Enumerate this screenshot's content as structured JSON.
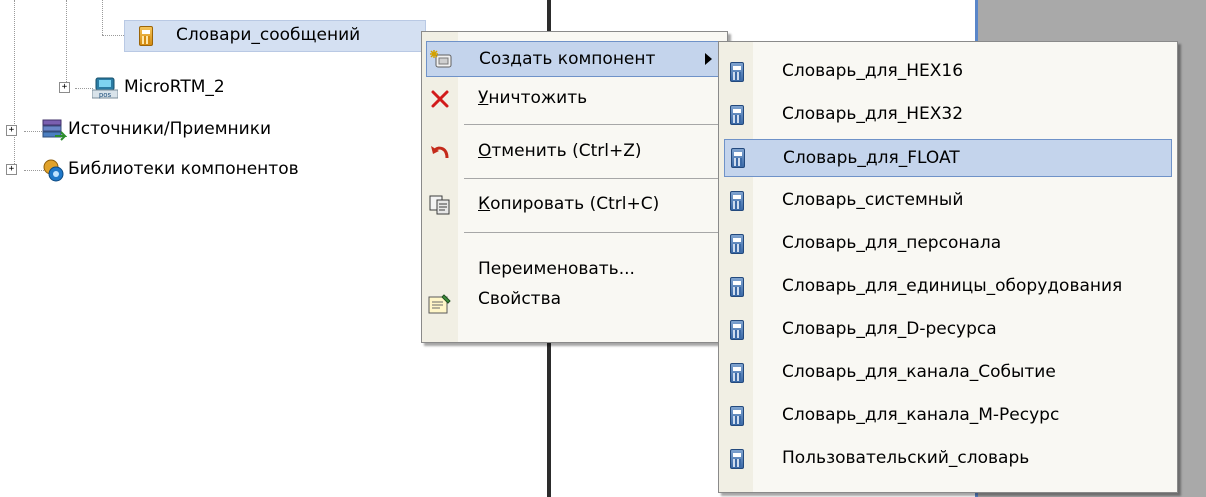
{
  "tree": {
    "items": [
      {
        "label": "Словари_сообщений",
        "icon": "message-dictionary-icon",
        "selected": true
      },
      {
        "label": "MicroRTM_2",
        "icon": "micrortm-icon",
        "icon_text": "pos",
        "expander": "+"
      },
      {
        "label": "Источники/Приемники",
        "icon": "sources-receivers-icon",
        "expander": "+"
      },
      {
        "label": "Библиотеки компонентов",
        "icon": "component-libraries-icon",
        "expander": "+"
      }
    ]
  },
  "context_menu": {
    "items": [
      {
        "label": "Создать компонент",
        "icon": "create-component-icon",
        "highlighted": true,
        "submenu": true
      },
      {
        "label_pre": "",
        "mnemonic": "У",
        "label_post": "ничтожить",
        "icon": "delete-icon"
      },
      {
        "label_pre": "",
        "mnemonic": "О",
        "label_post": "тменить (Ctrl+Z)",
        "icon": "undo-icon"
      },
      {
        "label_pre": "",
        "mnemonic": "К",
        "label_post": "опировать (Ctrl+C)",
        "icon": "copy-icon"
      },
      {
        "label": "Переименовать...",
        "icon": ""
      },
      {
        "label": "Свойства",
        "icon": "properties-icon"
      }
    ]
  },
  "submenu": {
    "items": [
      {
        "label": "Словарь_для_HEX16"
      },
      {
        "label": "Словарь_для_HEX32"
      },
      {
        "label": "Словарь_для_FLOAT",
        "highlighted": true
      },
      {
        "label": "Словарь_системный"
      },
      {
        "label": "Словарь_для_персонала"
      },
      {
        "label": "Словарь_для_единицы_оборудования"
      },
      {
        "label": "Словарь_для_D-ресурса"
      },
      {
        "label": "Словарь_для_канала_Событие"
      },
      {
        "label": "Словарь_для_канала_М-Ресурс"
      },
      {
        "label": "Пользовательский_словарь"
      }
    ],
    "icon": "dictionary-icon"
  },
  "colors": {
    "highlight": "#c4d4ec",
    "highlight_border": "#6f92c8",
    "menu_bg": "#f9f8f3",
    "selected_tree": "#d4e0f2"
  }
}
